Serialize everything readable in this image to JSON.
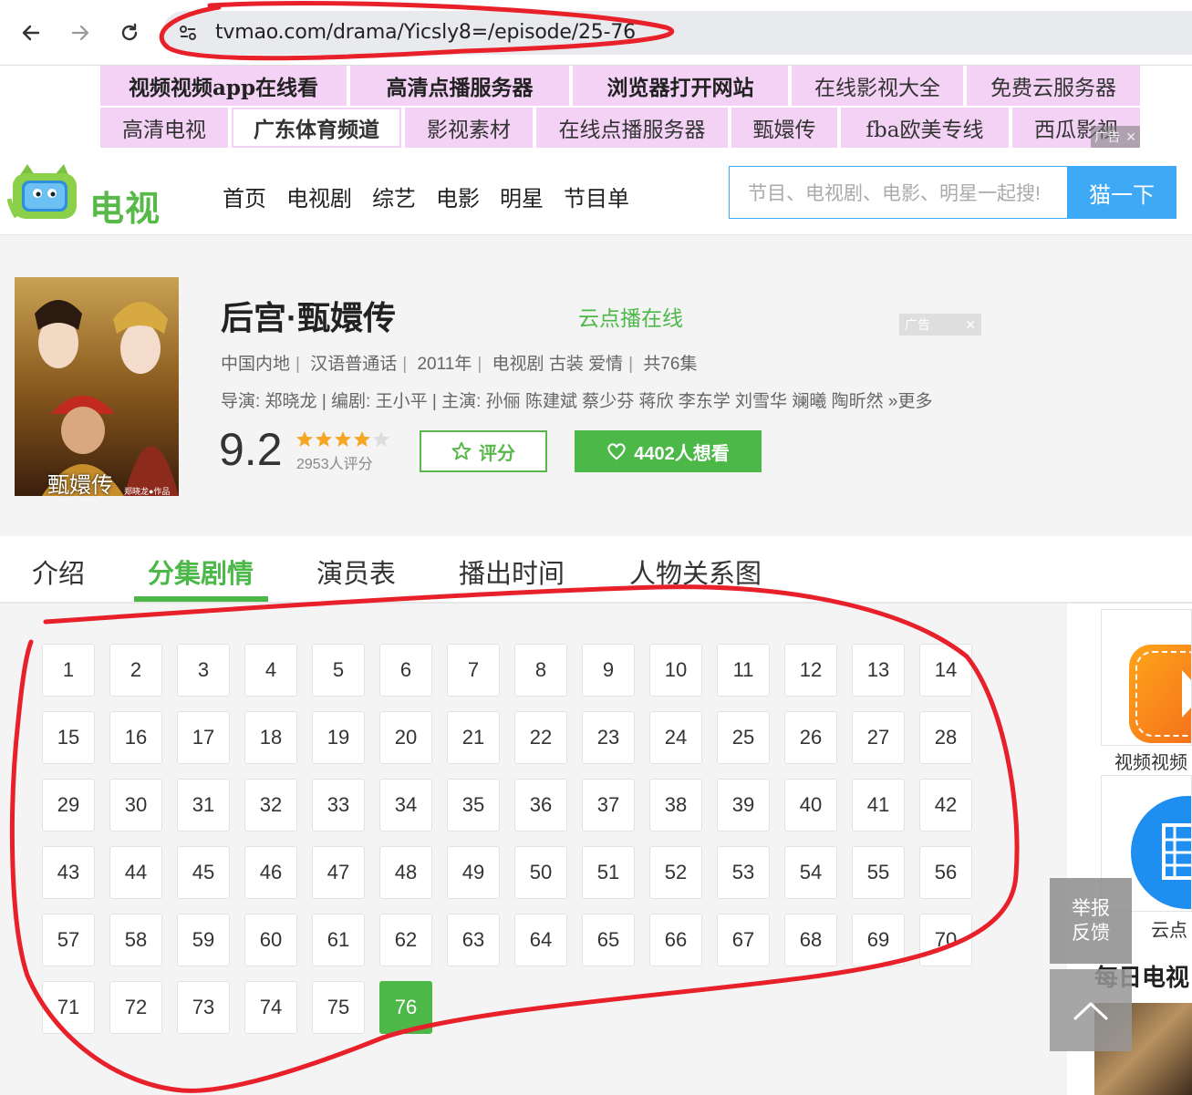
{
  "browser": {
    "url": "tvmao.com/drama/Yicsly8=/episode/25-76"
  },
  "ads": {
    "row1": [
      "视频视频app在线看",
      "高清点播服务器",
      "浏览器打开网站",
      "在线影视大全",
      "免费云服务器"
    ],
    "row2": [
      "高清电视",
      "广东体育频道",
      "影视素材",
      "在线点播服务器",
      "甄嬛传",
      "fba欧美专线",
      "西瓜影视"
    ],
    "tag": "广告"
  },
  "header": {
    "logo_text": "电视猫",
    "nav": [
      "首页",
      "电视剧",
      "综艺",
      "电影",
      "明星",
      "节目单"
    ],
    "search_placeholder": "节目、电视剧、电影、明星一起搜!",
    "search_button": "猫一下"
  },
  "drama": {
    "title": "后宫·甄嬛传",
    "cloud_link": "云点播在线",
    "ad_tag": "广告",
    "meta": [
      "中国内地",
      "汉语普通话",
      "2011年",
      "电视剧 古装 爱情",
      "共76集"
    ],
    "credits": "导演: 郑晓龙 | 编剧: 王小平 | 主演: 孙俪 陈建斌 蔡少芬 蒋欣 李东学 刘雪华 斓曦 陶昕然 »更多",
    "poster_caption": "甄嬛传",
    "poster_sub": "郑晓龙●作品",
    "score": "9.2",
    "stars": 4.5,
    "rating_count": "2953人评分",
    "rate_button": "评分",
    "want_button": "4402人想看"
  },
  "tabs": {
    "items": [
      "介绍",
      "分集剧情",
      "演员表",
      "播出时间",
      "人物关系图"
    ],
    "active_index": 1
  },
  "episodes": {
    "total": 76,
    "current": 76,
    "per_row": 14
  },
  "sidebar": {
    "card1_label": "视频视频",
    "card2_label": "云点",
    "daily_title": "每日电视",
    "report": "举报\n反馈"
  },
  "colors": {
    "green": "#4cb848",
    "blue": "#3ea9f5",
    "ad_pink": "#f3d2f5",
    "annotation_red": "#e8202a"
  }
}
